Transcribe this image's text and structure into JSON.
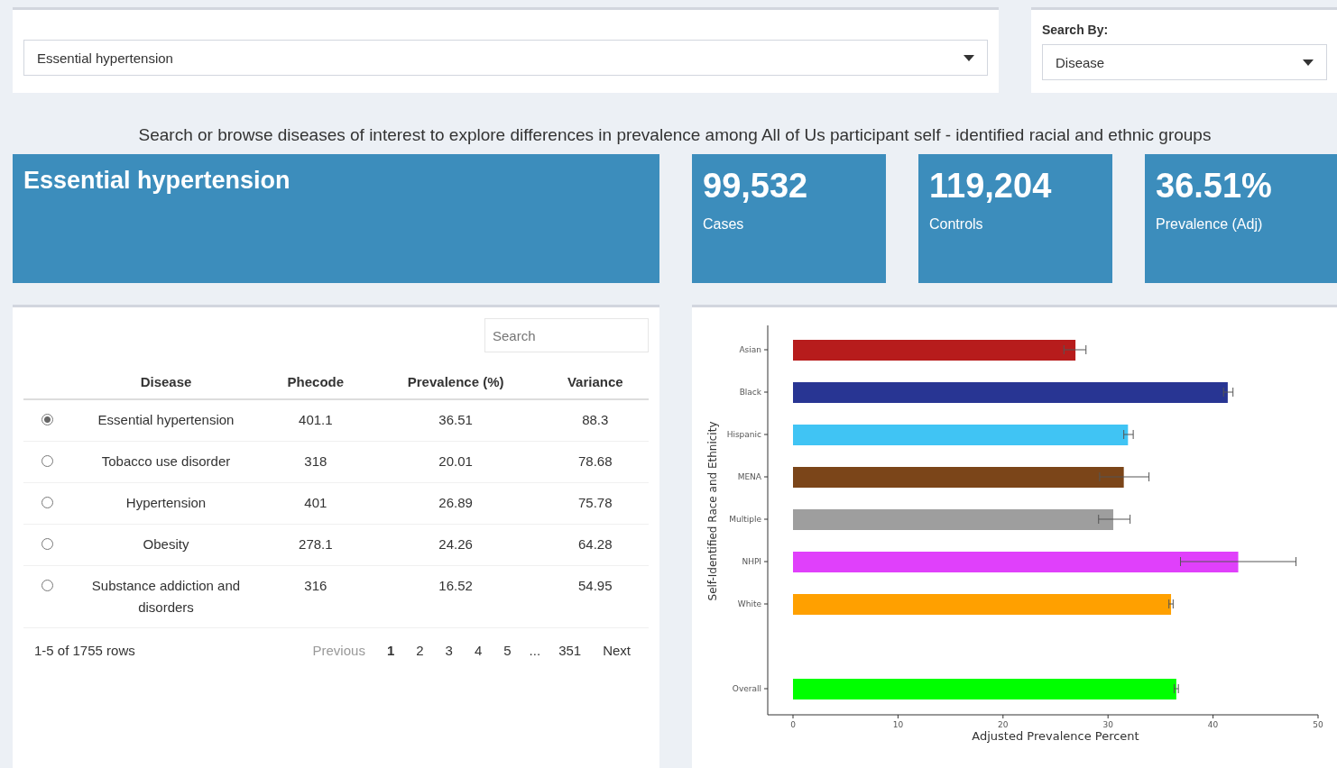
{
  "disease_select": {
    "value": "Essential hypertension"
  },
  "search_by": {
    "label": "Search By:",
    "value": "Disease"
  },
  "subtitle": "Search or browse diseases of interest to explore differences in prevalence among All of Us participant self - identified racial and ethnic groups",
  "title_box": {
    "title": "Essential hypertension"
  },
  "stat_boxes": [
    {
      "value": "99,532",
      "label": "Cases"
    },
    {
      "value": "119,204",
      "label": "Controls"
    },
    {
      "value": "36.51%",
      "label": "Prevalence (Adj)"
    }
  ],
  "table": {
    "search": {
      "placeholder": "Search"
    },
    "columns": [
      "Disease",
      "Phecode",
      "Prevalence (%)",
      "Variance"
    ],
    "rows": [
      {
        "selected": true,
        "cells": [
          "Essential hypertension",
          "401.1",
          "36.51",
          "88.3"
        ]
      },
      {
        "selected": false,
        "cells": [
          "Tobacco use disorder",
          "318",
          "20.01",
          "78.68"
        ]
      },
      {
        "selected": false,
        "cells": [
          "Hypertension",
          "401",
          "26.89",
          "75.78"
        ]
      },
      {
        "selected": false,
        "cells": [
          "Obesity",
          "278.1",
          "24.26",
          "64.28"
        ]
      },
      {
        "selected": false,
        "cells": [
          "Substance addiction and disorders",
          "316",
          "16.52",
          "54.95"
        ]
      }
    ],
    "info": "1-5 of 1755 rows",
    "pagination": [
      {
        "label": "Previous",
        "kind": "prev"
      },
      {
        "label": "1",
        "kind": "page",
        "selected": true
      },
      {
        "label": "2",
        "kind": "page",
        "selected": false
      },
      {
        "label": "3",
        "kind": "page",
        "selected": false
      },
      {
        "label": "4",
        "kind": "page",
        "selected": false
      },
      {
        "label": "5",
        "kind": "page",
        "selected": false
      },
      {
        "label": "...",
        "kind": "ellipsis"
      },
      {
        "label": "351",
        "kind": "page",
        "selected": false
      },
      {
        "label": "Next",
        "kind": "next"
      }
    ]
  },
  "chart": {
    "chart_data": {
      "type": "bar",
      "orientation": "horizontal",
      "xlabel": "Adjusted Prevalence Percent",
      "ylabel": "Self-Identified Race and Ethnicity",
      "categories": [
        "Asian",
        "Black",
        "Hispanic",
        "MENA",
        "Multiple",
        "NHPI",
        "White",
        "Overall"
      ],
      "series": [
        {
          "colors": [
            "#b71c1c",
            "#283593",
            "#40c4f4",
            "#7b4519",
            "#9e9e9e",
            "#e040fb",
            "#ffa000",
            "#00ff00"
          ],
          "values": [
            26.9,
            41.4,
            31.9,
            31.5,
            30.5,
            42.4,
            36.0,
            36.5
          ],
          "errors": [
            [
              25.8,
              27.9
            ],
            [
              41.0,
              41.9
            ],
            [
              31.5,
              32.4
            ],
            [
              29.2,
              33.9
            ],
            [
              29.1,
              32.1
            ],
            [
              36.9,
              47.9
            ],
            [
              35.8,
              36.2
            ],
            [
              36.3,
              36.7
            ]
          ]
        }
      ],
      "xlim": [
        0,
        50
      ],
      "xticks": [
        0,
        10,
        20,
        30,
        40,
        50
      ]
    }
  }
}
